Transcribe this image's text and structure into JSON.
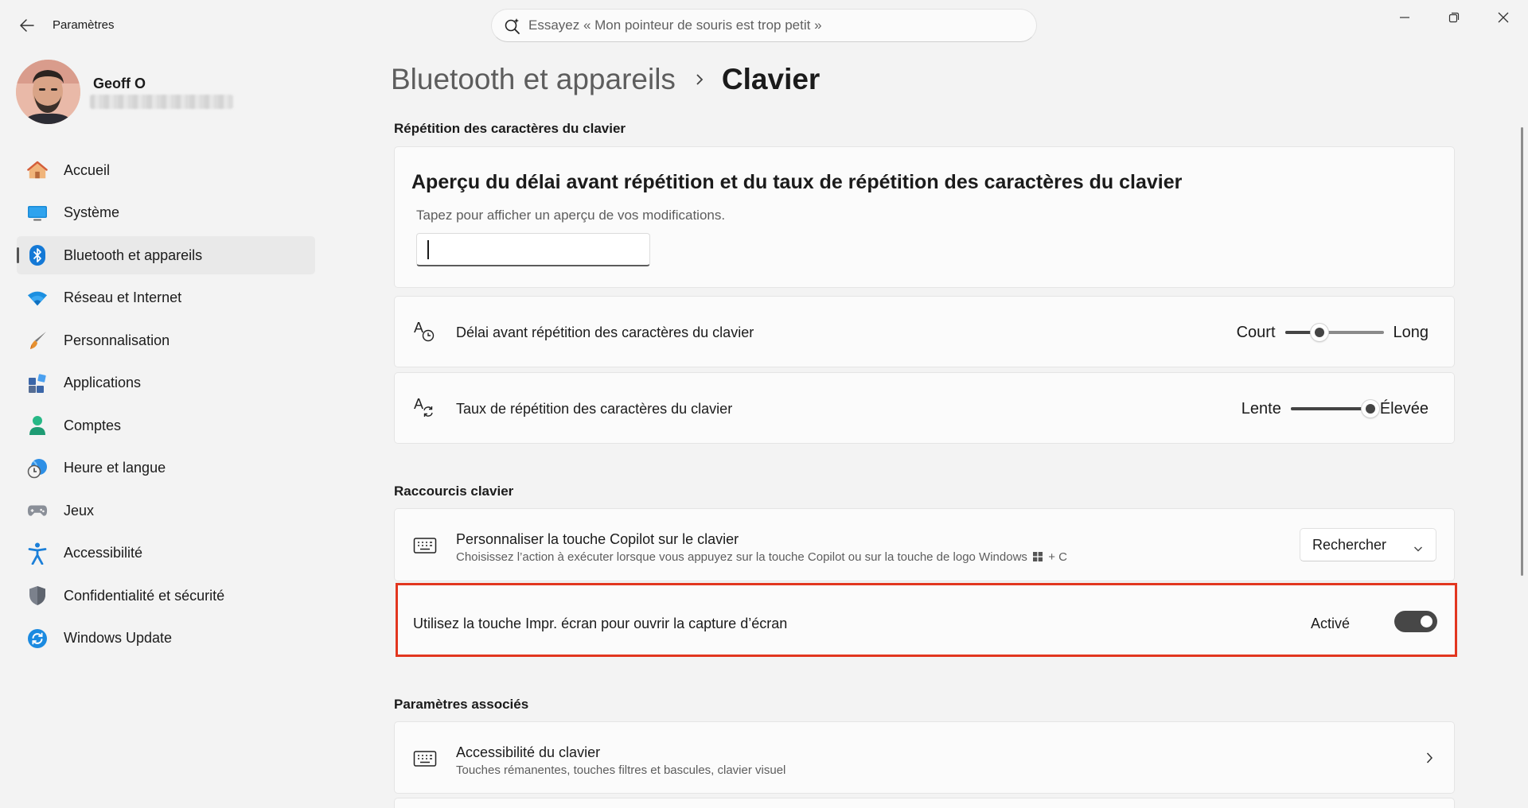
{
  "app": {
    "title": "Paramètres"
  },
  "search": {
    "placeholder": "Essayez « Mon pointeur de souris est trop petit »"
  },
  "window_controls": [
    "minimize",
    "restore",
    "close"
  ],
  "profile": {
    "name": "Geoff O"
  },
  "sidebar": {
    "items": [
      {
        "label": "Accueil",
        "icon": "home-icon"
      },
      {
        "label": "Système",
        "icon": "system-icon"
      },
      {
        "label": "Bluetooth et appareils",
        "icon": "bluetooth-icon",
        "active": true
      },
      {
        "label": "Réseau et Internet",
        "icon": "wifi-icon"
      },
      {
        "label": "Personnalisation",
        "icon": "brush-icon"
      },
      {
        "label": "Applications",
        "icon": "apps-icon"
      },
      {
        "label": "Comptes",
        "icon": "account-icon"
      },
      {
        "label": "Heure et langue",
        "icon": "clock-globe-icon"
      },
      {
        "label": "Jeux",
        "icon": "gamepad-icon"
      },
      {
        "label": "Accessibilité",
        "icon": "accessibility-icon"
      },
      {
        "label": "Confidentialité et sécurité",
        "icon": "shield-icon"
      },
      {
        "label": "Windows Update",
        "icon": "update-icon"
      }
    ]
  },
  "breadcrumb": {
    "parent": "Bluetooth et appareils",
    "current": "Clavier"
  },
  "sections": {
    "repetition": {
      "title": "Répétition des caractères du clavier",
      "preview": {
        "title": "Aperçu du délai avant répétition et du taux de répétition des caractères du clavier",
        "subtitle": "Tapez pour afficher un aperçu de vos modifications.",
        "input_value": ""
      },
      "delay": {
        "label": "Délai avant répétition des caractères du clavier",
        "min_label": "Court",
        "max_label": "Long",
        "value_fraction": 0.35
      },
      "rate": {
        "label": "Taux de répétition des caractères du clavier",
        "min_label": "Lente",
        "max_label": "Élevée",
        "value_fraction": 1.0
      }
    },
    "shortcuts": {
      "title": "Raccourcis clavier",
      "copilot": {
        "label": "Personnaliser la touche Copilot sur le clavier",
        "desc_before": "Choisissez l’action à exécuter lorsque vous appuyez sur la touche Copilot ou sur la touche de logo Windows",
        "desc_after": "+ C",
        "dropdown_value": "Rechercher"
      },
      "print_screen": {
        "label": "Utilisez la touche Impr. écran pour ouvrir la capture d’écran",
        "state_label": "Activé",
        "enabled": true,
        "highlight_color": "#e2361f"
      }
    },
    "related": {
      "title": "Paramètres associés",
      "keyboard_accessibility": {
        "label": "Accessibilité du clavier",
        "desc": "Touches rémanentes, touches filtres et bascules, clavier visuel"
      }
    }
  }
}
